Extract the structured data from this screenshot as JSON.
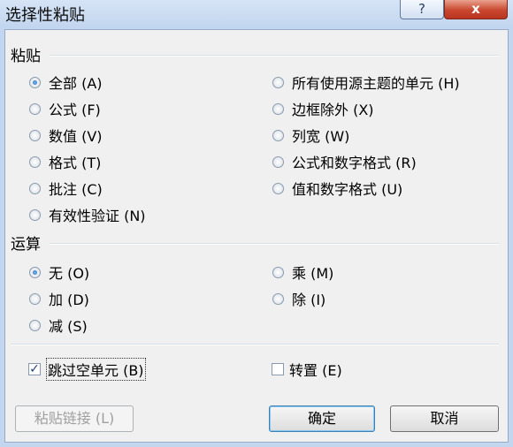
{
  "window": {
    "title": "选择性粘贴",
    "help_label": "?",
    "close_label": "x"
  },
  "paste": {
    "title": "粘贴",
    "selected": "全部 (A)",
    "options_left": [
      "全部 (A)",
      "公式 (F)",
      "数值 (V)",
      "格式 (T)",
      "批注 (C)",
      "有效性验证 (N)"
    ],
    "options_right": [
      "所有使用源主题的单元 (H)",
      "边框除外 (X)",
      "列宽 (W)",
      "公式和数字格式 (R)",
      "值和数字格式 (U)"
    ]
  },
  "operation": {
    "title": "运算",
    "selected": "无 (O)",
    "options_left": [
      "无 (O)",
      "加 (D)",
      "减 (S)"
    ],
    "options_right": [
      "乘 (M)",
      "除 (I)"
    ]
  },
  "checks": {
    "skip_blanks": {
      "label": "跳过空单元 (B)",
      "checked": true
    },
    "transpose": {
      "label": "转置 (E)",
      "checked": false
    }
  },
  "buttons": {
    "paste_link": "粘贴链接 (L)",
    "ok": "确定",
    "cancel": "取消"
  }
}
